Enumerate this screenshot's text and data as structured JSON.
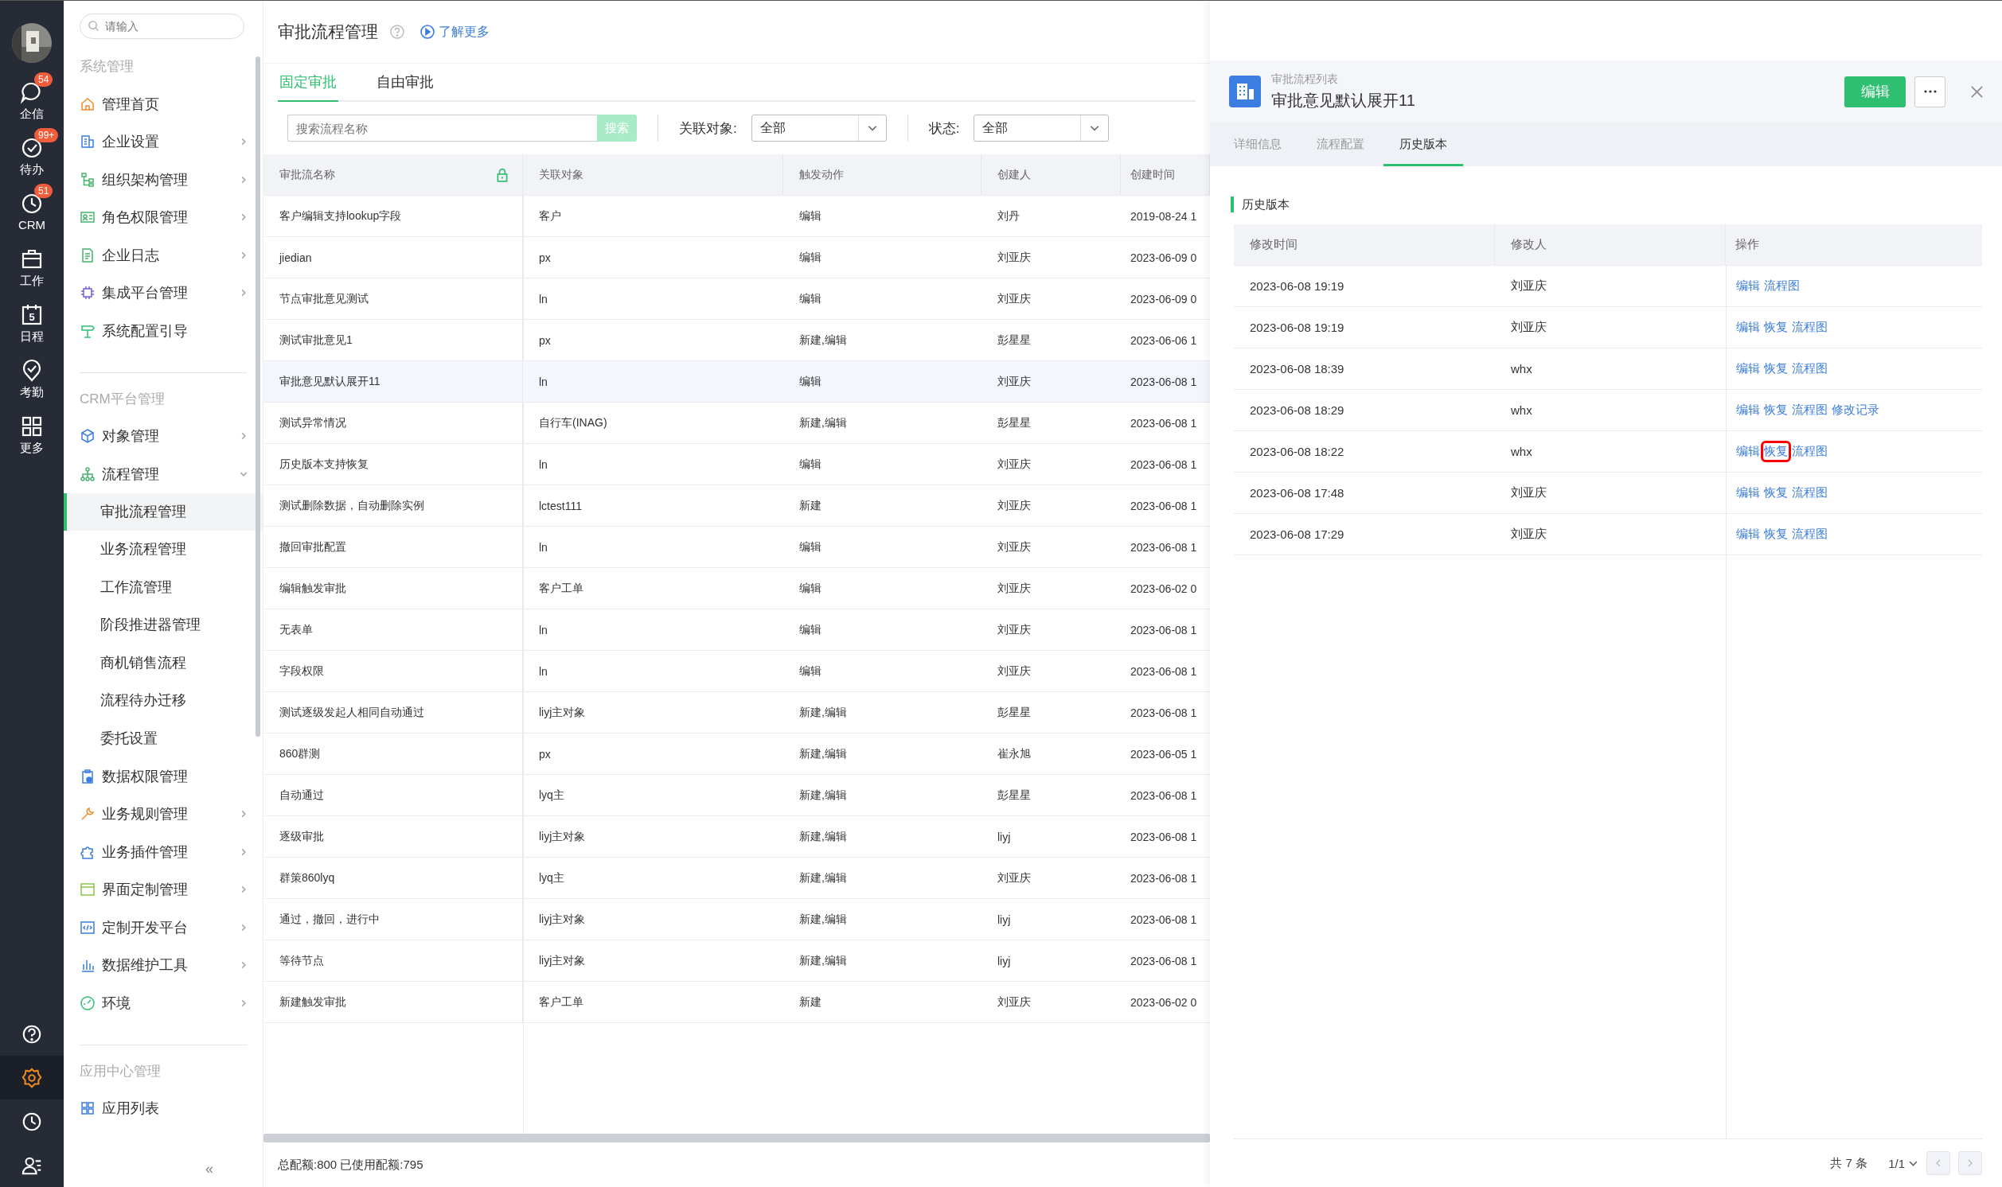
{
  "app_rail": {
    "items": [
      {
        "label": "企信",
        "badge": "54"
      },
      {
        "label": "待办",
        "badge": "99+"
      },
      {
        "label": "CRM",
        "badge": "51"
      },
      {
        "label": "工作"
      },
      {
        "label": "日程",
        "day": "5"
      },
      {
        "label": "考勤"
      },
      {
        "label": "更多"
      }
    ],
    "bottom": [
      {
        "selected": false
      },
      {
        "selected": true
      },
      {
        "selected": false
      },
      {
        "selected": false
      }
    ]
  },
  "sidebar": {
    "search": {
      "placeholder": "请输入"
    },
    "sections": [
      {
        "title": "系统管理",
        "items": [
          {
            "label": "管理首页",
            "has_submenu": false,
            "expanded": false
          },
          {
            "label": "企业设置",
            "has_submenu": true,
            "expanded": false
          },
          {
            "label": "组织架构管理",
            "has_submenu": true,
            "expanded": false
          },
          {
            "label": "角色权限管理",
            "has_submenu": true,
            "expanded": false
          },
          {
            "label": "企业日志",
            "has_submenu": true,
            "expanded": false
          },
          {
            "label": "集成平台管理",
            "has_submenu": true,
            "expanded": false
          },
          {
            "label": "系统配置引导",
            "has_submenu": false,
            "expanded": false
          }
        ]
      },
      {
        "title": "CRM平台管理",
        "items": [
          {
            "label": "对象管理",
            "has_submenu": true,
            "expanded": false
          },
          {
            "label": "流程管理",
            "has_submenu": true,
            "expanded": true,
            "children": [
              {
                "label": "审批流程管理",
                "selected": true
              },
              {
                "label": "业务流程管理",
                "selected": false
              },
              {
                "label": "工作流管理",
                "selected": false
              },
              {
                "label": "阶段推进器管理",
                "selected": false
              },
              {
                "label": "商机销售流程",
                "selected": false
              },
              {
                "label": "流程待办迁移",
                "selected": false
              },
              {
                "label": "委托设置",
                "selected": false
              }
            ]
          },
          {
            "label": "数据权限管理",
            "has_submenu": false,
            "expanded": false
          },
          {
            "label": "业务规则管理",
            "has_submenu": true,
            "expanded": false
          },
          {
            "label": "业务插件管理",
            "has_submenu": true,
            "expanded": false
          },
          {
            "label": "界面定制管理",
            "has_submenu": true,
            "expanded": false
          },
          {
            "label": "定制开发平台",
            "has_submenu": true,
            "expanded": false
          },
          {
            "label": "数据维护工具",
            "has_submenu": true,
            "expanded": false
          },
          {
            "label": "环境",
            "has_submenu": true,
            "expanded": false
          }
        ]
      },
      {
        "title": "应用中心管理",
        "items": [
          {
            "label": "应用列表",
            "has_submenu": false,
            "expanded": false
          }
        ]
      }
    ],
    "collapse": "«"
  },
  "page": {
    "title": "审批流程管理",
    "learn_more": "了解更多"
  },
  "tabs": [
    {
      "label": "固定审批",
      "selected": true
    },
    {
      "label": "自由审批",
      "selected": false
    }
  ],
  "filters": {
    "search": {
      "placeholder": "搜索流程名称"
    },
    "search_button": "搜索",
    "object_label": "关联对象:",
    "object_value": "全部",
    "status_label": "状态:",
    "status_value": "全部"
  },
  "table": {
    "columns": [
      {
        "label": "审批流名称",
        "locked": true
      },
      {
        "label": "关联对象",
        "locked": false
      },
      {
        "label": "触发动作",
        "locked": false
      },
      {
        "label": "创建人",
        "locked": false
      },
      {
        "label": "创建时间",
        "locked": false
      }
    ],
    "rows": [
      {
        "cells": [
          "客户编辑支持lookup字段",
          "客户",
          "编辑",
          "刘丹",
          "2019-08-24 1"
        ],
        "selected": false
      },
      {
        "cells": [
          "jiedian",
          "px",
          "编辑",
          "刘亚庆",
          "2023-06-09 0"
        ],
        "selected": false
      },
      {
        "cells": [
          "节点审批意见测试",
          "ln",
          "编辑",
          "刘亚庆",
          "2023-06-09 0"
        ],
        "selected": false
      },
      {
        "cells": [
          "测试审批意见1",
          "px",
          "新建,编辑",
          "彭星星",
          "2023-06-06 1"
        ],
        "selected": false
      },
      {
        "cells": [
          "审批意见默认展开11",
          "ln",
          "编辑",
          "刘亚庆",
          "2023-06-08 1"
        ],
        "selected": true
      },
      {
        "cells": [
          "测试异常情况",
          "自行车(INAG)",
          "新建,编辑",
          "彭星星",
          "2023-06-08 1"
        ],
        "selected": false
      },
      {
        "cells": [
          "历史版本支持恢复",
          "ln",
          "编辑",
          "刘亚庆",
          "2023-06-08 1"
        ],
        "selected": false
      },
      {
        "cells": [
          "测试删除数据，自动删除实例",
          "lctest111",
          "新建",
          "刘亚庆",
          "2023-06-08 1"
        ],
        "selected": false
      },
      {
        "cells": [
          "撤回审批配置",
          "ln",
          "编辑",
          "刘亚庆",
          "2023-06-08 1"
        ],
        "selected": false
      },
      {
        "cells": [
          "编辑触发审批",
          "客户工单",
          "编辑",
          "刘亚庆",
          "2023-06-02 0"
        ],
        "selected": false
      },
      {
        "cells": [
          "无表单",
          "ln",
          "编辑",
          "刘亚庆",
          "2023-06-08 1"
        ],
        "selected": false
      },
      {
        "cells": [
          "字段权限",
          "ln",
          "编辑",
          "刘亚庆",
          "2023-06-08 1"
        ],
        "selected": false
      },
      {
        "cells": [
          "测试逐级发起人相同自动通过",
          "liyj主对象",
          "新建,编辑",
          "彭星星",
          "2023-06-08 1"
        ],
        "selected": false
      },
      {
        "cells": [
          "860群测",
          "px",
          "新建,编辑",
          "崔永旭",
          "2023-06-05 1"
        ],
        "selected": false
      },
      {
        "cells": [
          "自动通过",
          "lyq主",
          "新建,编辑",
          "彭星星",
          "2023-06-08 1"
        ],
        "selected": false
      },
      {
        "cells": [
          "逐级审批",
          "liyj主对象",
          "新建,编辑",
          "liyj",
          "2023-06-08 1"
        ],
        "selected": false
      },
      {
        "cells": [
          "群策860lyq",
          "lyq主",
          "新建,编辑",
          "刘亚庆",
          "2023-06-08 1"
        ],
        "selected": false
      },
      {
        "cells": [
          "通过，撤回，进行中",
          "liyj主对象",
          "新建,编辑",
          "liyj",
          "2023-06-08 1"
        ],
        "selected": false
      },
      {
        "cells": [
          "等待节点",
          "liyj主对象",
          "新建,编辑",
          "liyj",
          "2023-06-08 1"
        ],
        "selected": false
      },
      {
        "cells": [
          "新建触发审批",
          "客户工单",
          "新建",
          "刘亚庆",
          "2023-06-02 0"
        ],
        "selected": false
      }
    ]
  },
  "quota": "总配额:800 已使用配额:795",
  "detail_panel": {
    "breadcrumb": "审批流程列表",
    "title": "审批意见默认展开11",
    "edit_button": "编辑",
    "tabs": [
      {
        "label": "详细信息",
        "selected": false
      },
      {
        "label": "流程配置",
        "selected": false
      },
      {
        "label": "历史版本",
        "selected": true
      }
    ],
    "section_title": "历史版本",
    "history": {
      "columns": [
        "修改时间",
        "修改人",
        "操作"
      ],
      "rows": [
        {
          "time": "2023-06-08 19:19",
          "editor": "刘亚庆",
          "actions": [
            {
              "label": "编辑",
              "highlighted": false
            },
            {
              "label": "流程图",
              "highlighted": false
            }
          ]
        },
        {
          "time": "2023-06-08 19:19",
          "editor": "刘亚庆",
          "actions": [
            {
              "label": "编辑",
              "highlighted": false
            },
            {
              "label": "恢复",
              "highlighted": false
            },
            {
              "label": "流程图",
              "highlighted": false
            }
          ]
        },
        {
          "time": "2023-06-08 18:39",
          "editor": "whx",
          "actions": [
            {
              "label": "编辑",
              "highlighted": false
            },
            {
              "label": "恢复",
              "highlighted": false
            },
            {
              "label": "流程图",
              "highlighted": false
            }
          ]
        },
        {
          "time": "2023-06-08 18:29",
          "editor": "whx",
          "actions": [
            {
              "label": "编辑",
              "highlighted": false
            },
            {
              "label": "恢复",
              "highlighted": false
            },
            {
              "label": "流程图",
              "highlighted": false
            },
            {
              "label": "修改记录",
              "highlighted": false
            }
          ]
        },
        {
          "time": "2023-06-08 18:22",
          "editor": "whx",
          "actions": [
            {
              "label": "编辑",
              "highlighted": false
            },
            {
              "label": "恢复",
              "highlighted": true
            },
            {
              "label": "流程图",
              "highlighted": false
            }
          ]
        },
        {
          "time": "2023-06-08 17:48",
          "editor": "刘亚庆",
          "actions": [
            {
              "label": "编辑",
              "highlighted": false
            },
            {
              "label": "恢复",
              "highlighted": false
            },
            {
              "label": "流程图",
              "highlighted": false
            }
          ]
        },
        {
          "time": "2023-06-08 17:29",
          "editor": "刘亚庆",
          "actions": [
            {
              "label": "编辑",
              "highlighted": false
            },
            {
              "label": "恢复",
              "highlighted": false
            },
            {
              "label": "流程图",
              "highlighted": false
            }
          ]
        }
      ]
    },
    "pagination": {
      "total": "共 7 条",
      "page": "1/1"
    }
  }
}
